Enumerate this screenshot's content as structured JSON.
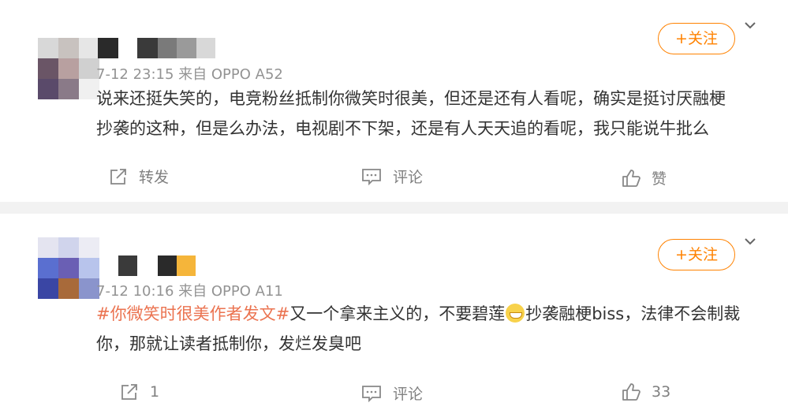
{
  "posts": [
    {
      "meta": "7-12 23:15 来自 OPPO A52",
      "follow_label": "+关注",
      "text_lines": [
        "说来还挺失笑的，电竞粉丝抵制你微笑时很美，但还是还有人看呢，确实是挺讨厌融梗",
        "抄袭的这种，但是么办法，电视剧不下架，还是有人天天追的看呢，我只能说牛批么"
      ],
      "actions": {
        "repost": "转发",
        "comment": "评论",
        "like": "赞"
      }
    },
    {
      "meta": "7-12 10:16 来自 OPPO A11",
      "follow_label": "+关注",
      "topic": "#你微笑时很美作者发文#",
      "line1_a": "又一个拿来主义的，不要碧莲",
      "line1_b": "抄袭融梗biss，法律不会制裁",
      "line2": "你，那就让读者抵制你，发烂发臭吧",
      "actions": {
        "repost": "1",
        "comment": "评论",
        "like": "33"
      }
    }
  ],
  "colors": {
    "accent": "#ff8200",
    "topic": "#eb7350",
    "meta": "#939393",
    "divider": "#f2f2f2"
  },
  "icons": [
    "repost-icon",
    "comment-icon",
    "like-icon",
    "chevron-down-icon",
    "grin-emoji"
  ]
}
